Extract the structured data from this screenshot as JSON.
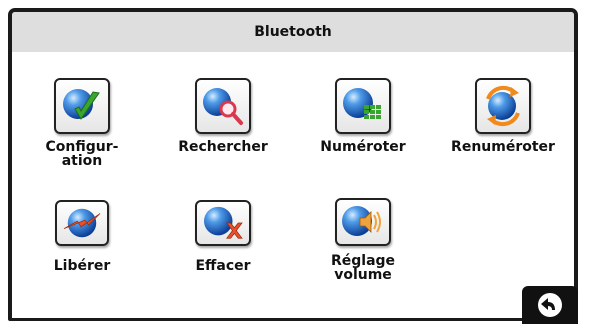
{
  "title": "Bluetooth",
  "items": [
    {
      "label": "Configur-\nation",
      "icon": "configuration-icon"
    },
    {
      "label": "Rechercher",
      "icon": "search-icon"
    },
    {
      "label": "Numéroter",
      "icon": "dialpad-icon"
    },
    {
      "label": "Renuméroter",
      "icon": "redial-icon"
    },
    {
      "label": "Libérer",
      "icon": "release-icon"
    },
    {
      "label": "Effacer",
      "icon": "delete-icon"
    },
    {
      "label": "Réglage\nvolume",
      "icon": "volume-icon"
    }
  ],
  "back_icon": "back-arrow-icon",
  "colors": {
    "titlebar": "#dedede",
    "frame": "#1a1a1a",
    "sphere": "#1f6fd6"
  }
}
